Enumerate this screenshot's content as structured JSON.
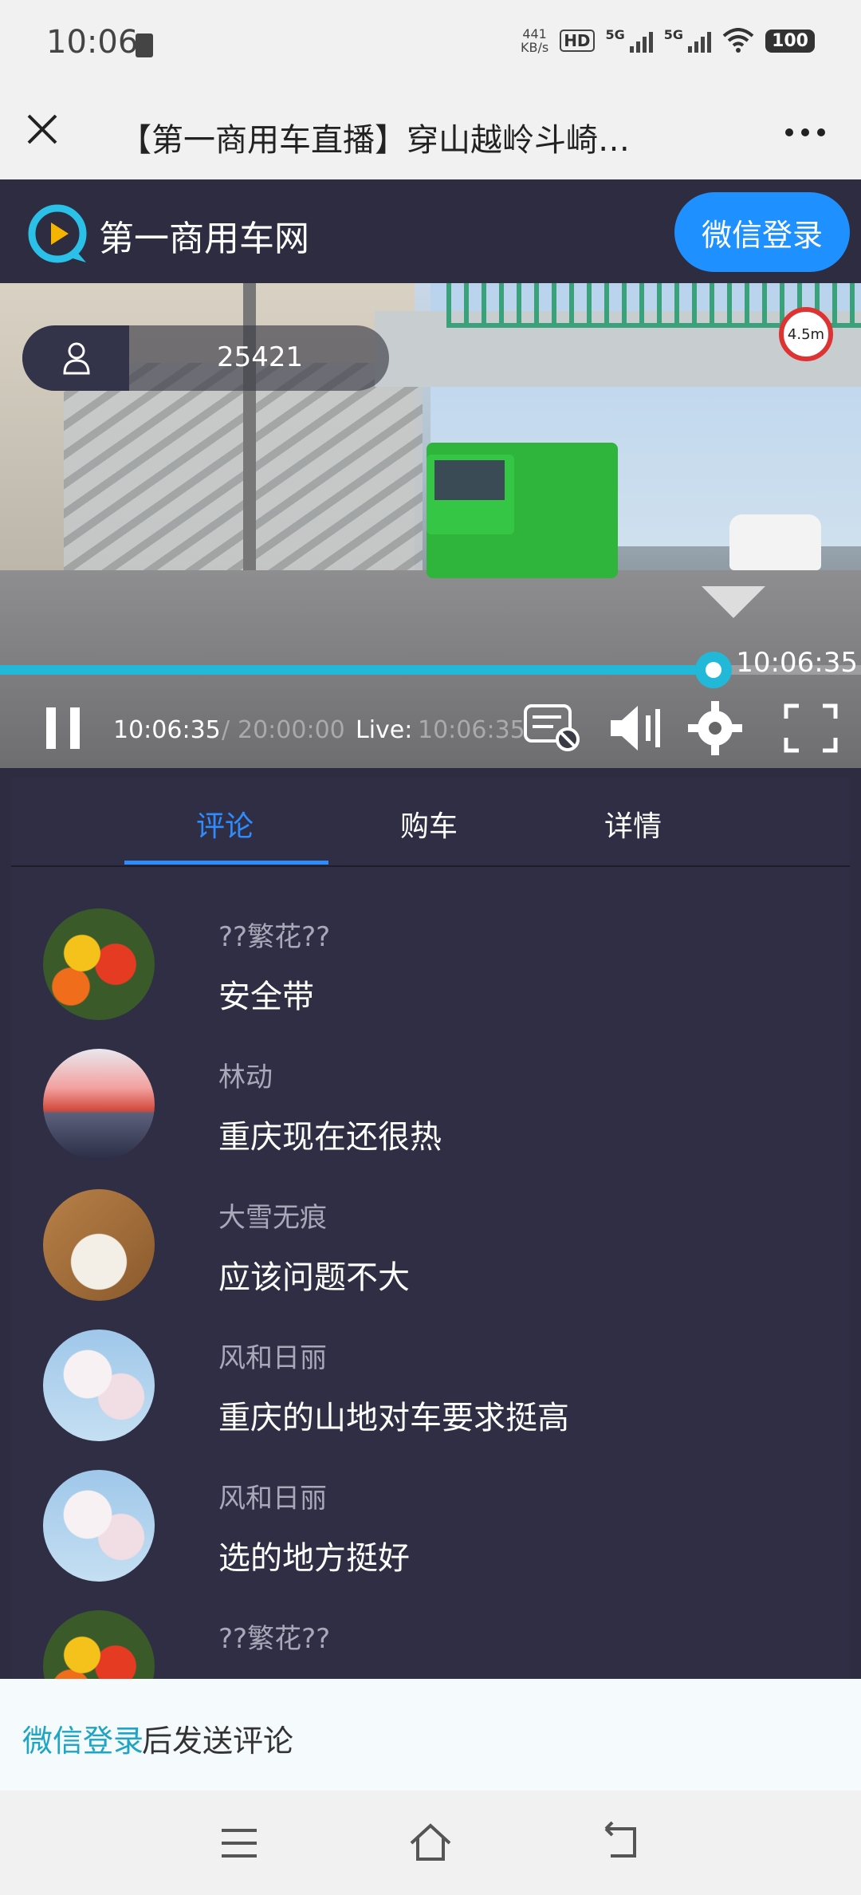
{
  "status_bar": {
    "time": "10:06",
    "speed_value": "441",
    "speed_unit": "KB/s",
    "hd_label": "HD",
    "net1": "5G",
    "net2": "5G",
    "battery": "100"
  },
  "title_bar": {
    "title": "【第一商用车直播】穿山越岭斗崎…"
  },
  "site": {
    "name": "第一商用车网",
    "login_button": "微信登录"
  },
  "player": {
    "viewer_count": "25421",
    "road_sign": "4.5m",
    "progress_fraction": 0.83,
    "scrub_time": "10:06:35",
    "current_time": "10:06:35",
    "separator": "/",
    "total_time": "20:00:00",
    "live_label": "Live:",
    "live_time": "10:06:35"
  },
  "tabs": [
    {
      "label": "评论",
      "active": true
    },
    {
      "label": "购车",
      "active": false
    },
    {
      "label": "详情",
      "active": false
    }
  ],
  "comments": [
    {
      "user": "??繁花??",
      "text": "安全带",
      "avatar": "flowers-avatar"
    },
    {
      "user": "林动",
      "text": "重庆现在还很热",
      "avatar": "sunset-avatar"
    },
    {
      "user": "大雪无痕",
      "text": "应该问题不大",
      "avatar": "fox-avatar"
    },
    {
      "user": "风和日丽",
      "text": "重庆的山地对车要求挺高",
      "avatar": "blossom-avatar"
    },
    {
      "user": "风和日丽",
      "text": "选的地方挺好",
      "avatar": "blossom-avatar"
    },
    {
      "user": "??繁花??",
      "text": "",
      "avatar": "flowers-avatar"
    }
  ],
  "bottom": {
    "login_link": "微信登录",
    "hint": "后发送评论"
  },
  "colors": {
    "accent": "#1e90ff",
    "progress": "#22b8d8",
    "tab_active": "#2f8cff",
    "panel_bg": "#2f2e44"
  }
}
